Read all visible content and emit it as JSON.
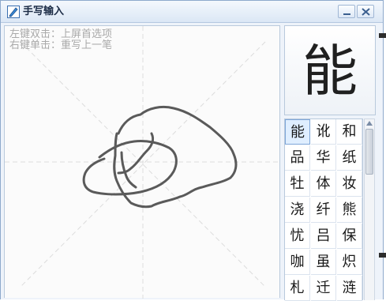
{
  "window": {
    "title": "手写输入",
    "minimize_label": "minimize",
    "close_label": "close"
  },
  "canvas": {
    "hint_double_click": "左键双击：上屏首选项",
    "hint_right_click": "右键单击：重写上一笔"
  },
  "preview": {
    "char": "能"
  },
  "candidates": [
    [
      "能",
      "讹",
      "和"
    ],
    [
      "品",
      "华",
      "纸"
    ],
    [
      "牡",
      "体",
      "妆"
    ],
    [
      "浇",
      "纤",
      "熊"
    ],
    [
      "忧",
      "吕",
      "保"
    ],
    [
      "咖",
      "虽",
      "炽"
    ],
    [
      "札",
      "迁",
      "涟"
    ]
  ],
  "selected_index": 0,
  "icons": {
    "app": "handwriting-pen-icon",
    "minimize": "minimize-icon",
    "close": "close-icon",
    "scroll_up": "scroll-up-arrow-icon"
  },
  "colors": {
    "title_bar": "#dbe7f5",
    "stroke": "#5a5a5a",
    "hint_text": "#a9a9a9",
    "selected_candidate": "#dfeeff"
  }
}
